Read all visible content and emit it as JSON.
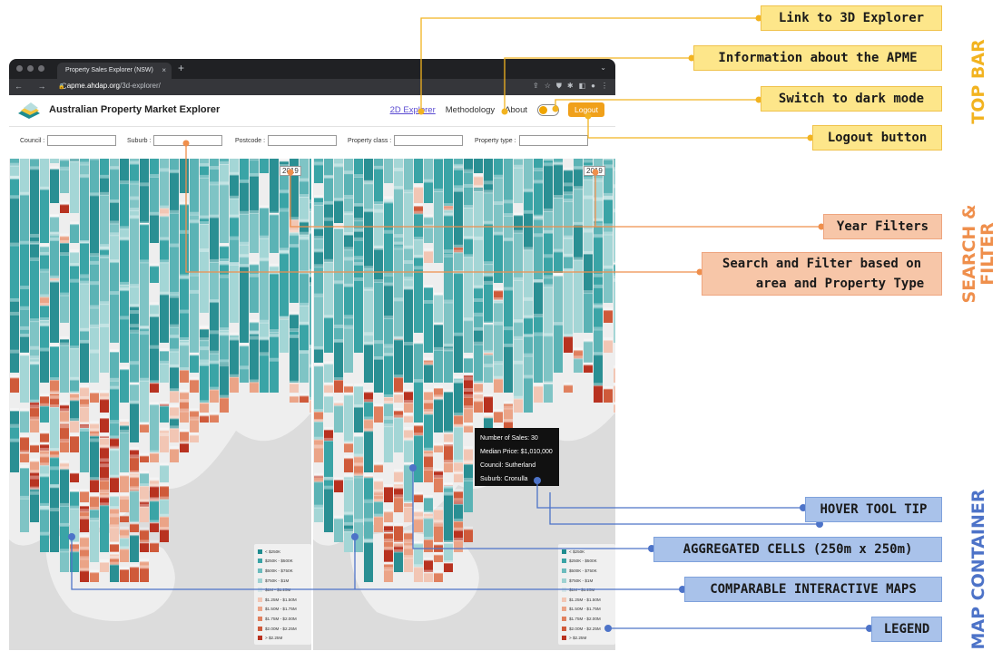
{
  "browser": {
    "tab_title": "Property Sales Explorer (NSW)",
    "tab_close": "×",
    "new_tab": "+",
    "tab_menu": "⌄",
    "nav_icons": "← → C",
    "lock": "🔒",
    "url_domain": "apme.ahdap.org",
    "url_path": "/3d-explorer/",
    "icons": [
      "⇪",
      "☆",
      "⛊",
      "✱",
      "◧",
      "●",
      "⋮"
    ]
  },
  "app": {
    "title": "Australian Property Market Explorer",
    "nav": {
      "explorer_2d": "2D Explorer",
      "methodology": "Methodology",
      "about": "About",
      "logout": "Logout"
    }
  },
  "filters": {
    "council": "Council :",
    "suburb": "Suburb :",
    "postcode": "Postcode :",
    "property_class": "Property class :",
    "property_type": "Property type :"
  },
  "maps": {
    "year_left": "2019",
    "year_right": "2019"
  },
  "legend": {
    "items": [
      {
        "label": "< $250K",
        "color": "#1f8c8f"
      },
      {
        "label": "$250K - $500K",
        "color": "#3aa4a6"
      },
      {
        "label": "$500K - $750K",
        "color": "#6cbcbe"
      },
      {
        "label": "$750K - $1M",
        "color": "#9fd2d2"
      },
      {
        "label": "$1M - $1.25M",
        "color": "#d8e6e6"
      },
      {
        "label": "$1.25M - $1.50M",
        "color": "#f2c6b4"
      },
      {
        "label": "$1.50M - $1.75M",
        "color": "#eba487"
      },
      {
        "label": "$1.75M - $2.00M",
        "color": "#e0805e"
      },
      {
        "label": "$2.00M - $2.25M",
        "color": "#cf5a3a"
      },
      {
        "label": "> $2.25M",
        "color": "#b83220"
      }
    ]
  },
  "tooltip": {
    "number_of_sales": "Number of Sales: 30",
    "median_price": "Median Price: $1,010,000",
    "council": "Council: Sutherland",
    "suburb": "Suburb: Cronulla"
  },
  "annotations": {
    "link_3d": "Link to 3D Explorer",
    "info_apme": "Information about the APME",
    "dark_mode": "Switch to dark mode",
    "logout": "Logout button",
    "year_filters": "Year Filters",
    "search_line1": "Search and Filter based on",
    "search_line2": "area and Property Type",
    "hover": "HOVER TOOL TIP",
    "aggregated": "AGGREGATED CELLS (250m x 250m)",
    "comparable": "COMPARABLE INTERACTIVE MAPS",
    "legend": "LEGEND"
  },
  "sections": {
    "top_bar": "TOP BAR",
    "search_1": "SEARCH &",
    "search_2": "FILTER",
    "map_container": "MAP CONTAINER"
  },
  "colors": {
    "top_bar_accent": "#f2b320",
    "search_accent": "#ef8f4c",
    "map_accent": "#4d73c8"
  }
}
